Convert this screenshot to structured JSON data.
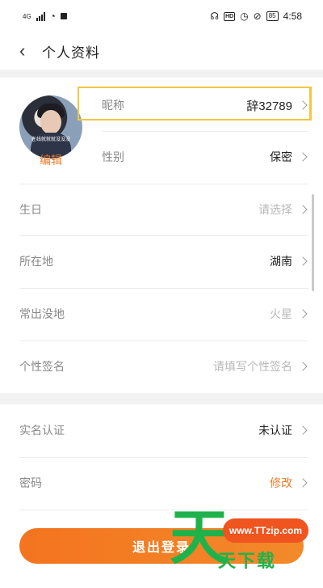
{
  "status_bar": {
    "network": "4G",
    "hd": "HD",
    "battery": "85",
    "time": "4:58"
  },
  "header": {
    "back_glyph": "‹",
    "title": "个人资料"
  },
  "profile": {
    "avatar_caption": "在线就就就没没没",
    "edit_label": "编辑"
  },
  "fields": [
    {
      "label": "昵称",
      "value": "辞32789",
      "style": "value"
    },
    {
      "label": "性别",
      "value": "保密",
      "style": "value"
    },
    {
      "label": "生日",
      "value": "请选择",
      "style": "placeholder"
    },
    {
      "label": "所在地",
      "value": "湖南",
      "style": "value"
    },
    {
      "label": "常出没地",
      "value": "火星",
      "style": "placeholder"
    },
    {
      "label": "个性签名",
      "value": "请填写个性签名",
      "style": "placeholder"
    }
  ],
  "security": [
    {
      "label": "实名认证",
      "value": "未认证",
      "style": "value"
    },
    {
      "label": "密码",
      "value": "修改",
      "style": "accent"
    }
  ],
  "logout_label": "退出登录",
  "watermark": {
    "big_char": "天",
    "url": "www.TTzip.com",
    "text": "天下载"
  },
  "colors": {
    "accent": "#f07b2b",
    "highlight": "#f5c542",
    "watermark_green": "#1fb24b"
  }
}
